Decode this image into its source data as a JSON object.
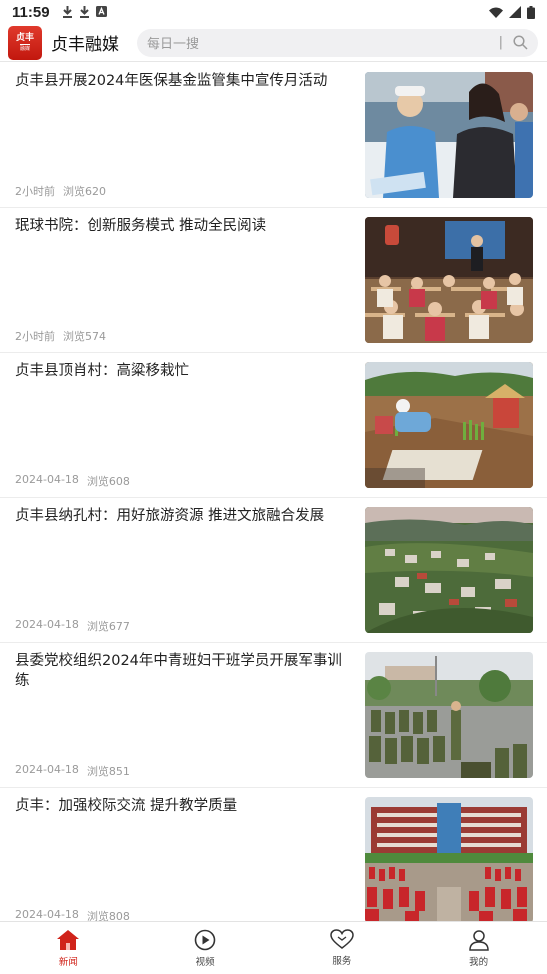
{
  "status_bar": {
    "time": "11:59"
  },
  "app": {
    "name": "贞丰融媒",
    "logo_text": "贞丰",
    "logo_sub": "融媒"
  },
  "search": {
    "placeholder": "每日一搜",
    "divider": "|"
  },
  "news": [
    {
      "title": "贞丰县开展2024年医保基金监管集中宣传月活动",
      "time": "2小时前",
      "views": "浏览620"
    },
    {
      "title": "珉球书院：创新服务模式 推动全民阅读",
      "time": "2小时前",
      "views": "浏览574"
    },
    {
      "title": "贞丰县顶肖村：高粱移栽忙",
      "time": "2024-04-18",
      "views": "浏览608"
    },
    {
      "title": "贞丰县纳孔村：用好旅游资源 推进文旅融合发展",
      "time": "2024-04-18",
      "views": "浏览677"
    },
    {
      "title": "县委党校组织2024年中青班妇干班学员开展军事训练",
      "time": "2024-04-18",
      "views": "浏览851"
    },
    {
      "title": "贞丰：加强校际交流 提升教学质量",
      "time": "2024-04-18",
      "views": "浏览808"
    }
  ],
  "nav": [
    {
      "label": "新闻",
      "icon": "home-icon",
      "active": true
    },
    {
      "label": "视频",
      "icon": "play-icon",
      "active": false
    },
    {
      "label": "服务",
      "icon": "heart-icon",
      "active": false
    },
    {
      "label": "我的",
      "icon": "user-icon",
      "active": false
    }
  ],
  "colors": {
    "accent": "#d0231a",
    "search_bg": "#f0f0f2",
    "meta": "#9a9a9a"
  }
}
